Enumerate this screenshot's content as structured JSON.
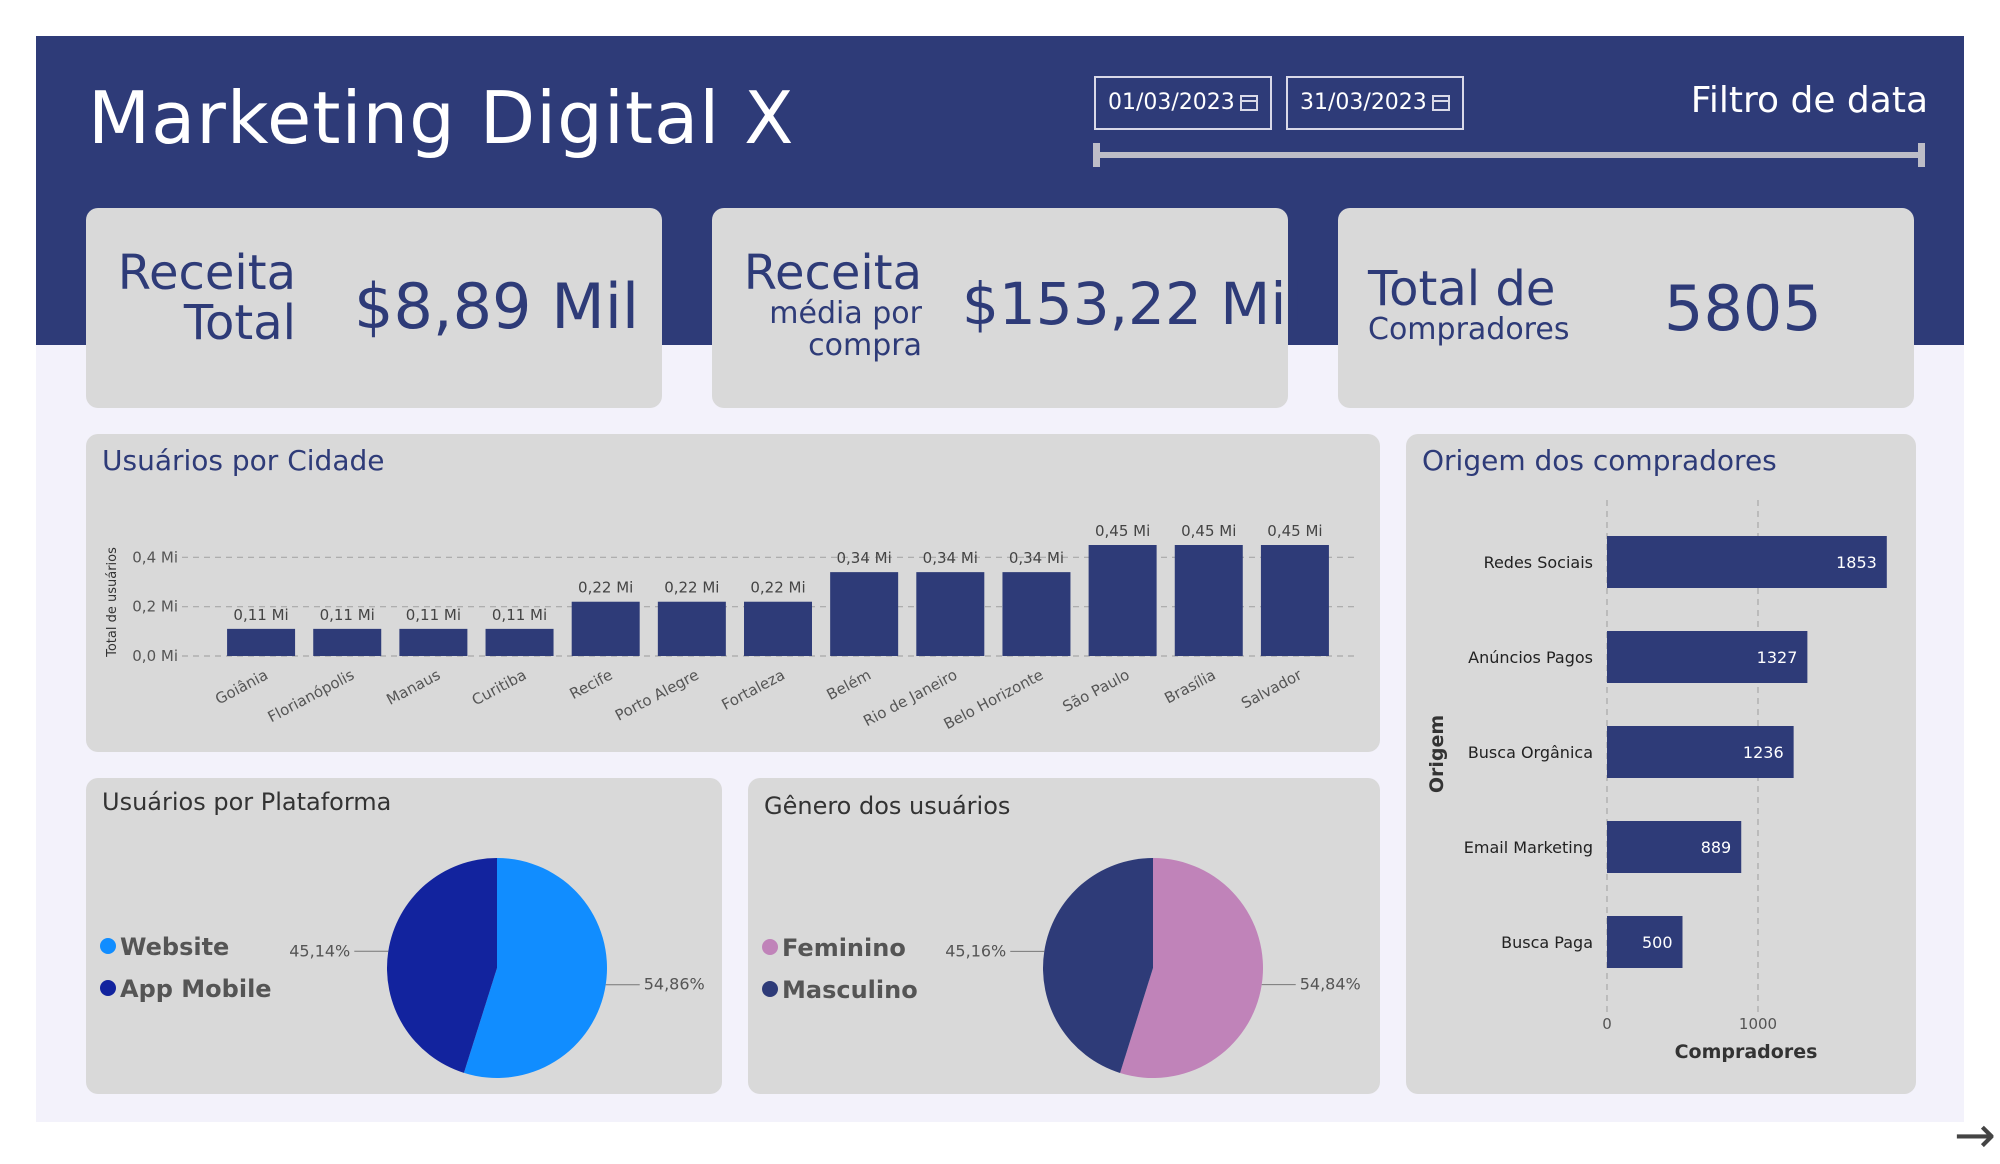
{
  "header": {
    "title": "Marketing Digital X",
    "start_date": "01/03/2023",
    "end_date": "31/03/2023",
    "filter_label": "Filtro de data",
    "date_slider_range": [
      0,
      1
    ]
  },
  "kpis": {
    "revenue_total": {
      "label_line1": "Receita",
      "label_line2": "Total",
      "value": "$8,89 Mil"
    },
    "revenue_avg": {
      "label_line1": "Receita",
      "label_line2": "média por",
      "label_line3": "compra",
      "value": "$153,22 Mil"
    },
    "buyers_total": {
      "label_line1": "Total de",
      "label_line2": "Compradores",
      "value": "5805"
    }
  },
  "colors": {
    "primary": "#2e3b78",
    "panel": "#d9d9d9",
    "background": "#f3f2fb",
    "website": "#118dff",
    "app_mobile": "#12239e",
    "feminino": "#c083b9",
    "masculino": "#2e3b78"
  },
  "icons": {
    "date_picker": "calendar-icon",
    "navigation": "arrow-right-icon"
  },
  "city_chart": {
    "title": "Usuários por Cidade",
    "chart_data": {
      "type": "bar",
      "categories": [
        "Goiânia",
        "Florianópolis",
        "Manaus",
        "Curitiba",
        "Recife",
        "Porto Alegre",
        "Fortaleza",
        "Belém",
        "Rio de Janeiro",
        "Belo Horizonte",
        "São Paulo",
        "Brasília",
        "Salvador"
      ],
      "values": [
        0.11,
        0.11,
        0.11,
        0.11,
        0.22,
        0.22,
        0.22,
        0.34,
        0.34,
        0.34,
        0.45,
        0.45,
        0.45
      ],
      "data_labels": [
        "0,11 Mi",
        "0,11 Mi",
        "0,11 Mi",
        "0,11 Mi",
        "0,22 Mi",
        "0,22 Mi",
        "0,22 Mi",
        "0,34 Mi",
        "0,34 Mi",
        "0,34 Mi",
        "0,45 Mi",
        "0,45 Mi",
        "0,45 Mi"
      ],
      "ylabel": "Total de usuários",
      "yticks": [
        0,
        0.2,
        0.4
      ],
      "ytick_labels": [
        "0,0 Mi",
        "0,2 Mi",
        "0,4 Mi"
      ],
      "ylim": [
        0,
        0.45
      ],
      "grid": true
    }
  },
  "platform_chart": {
    "title": "Usuários por Plataforma",
    "chart_data": {
      "type": "pie",
      "categories": [
        "Website",
        "App Mobile"
      ],
      "values": [
        54.86,
        45.14
      ],
      "data_labels": [
        "54,86%",
        "45,14%"
      ],
      "legend": "left"
    }
  },
  "gender_chart": {
    "title": "Gênero dos usuários",
    "chart_data": {
      "type": "pie",
      "categories": [
        "Feminino",
        "Masculino"
      ],
      "values": [
        54.84,
        45.16
      ],
      "data_labels": [
        "54,84%",
        "45,16%"
      ],
      "legend": "left"
    }
  },
  "origin_chart": {
    "title": "Origem dos compradores",
    "chart_data": {
      "type": "bar",
      "orientation": "horizontal",
      "categories": [
        "Redes Sociais",
        "Anúncios Pagos",
        "Busca Orgânica",
        "Email Marketing",
        "Busca Paga"
      ],
      "values": [
        1853,
        1327,
        1236,
        889,
        500
      ],
      "xlabel": "Compradores",
      "ylabel": "Origem",
      "xticks": [
        0,
        1000
      ],
      "xlim": [
        0,
        2000
      ],
      "grid": true
    }
  }
}
